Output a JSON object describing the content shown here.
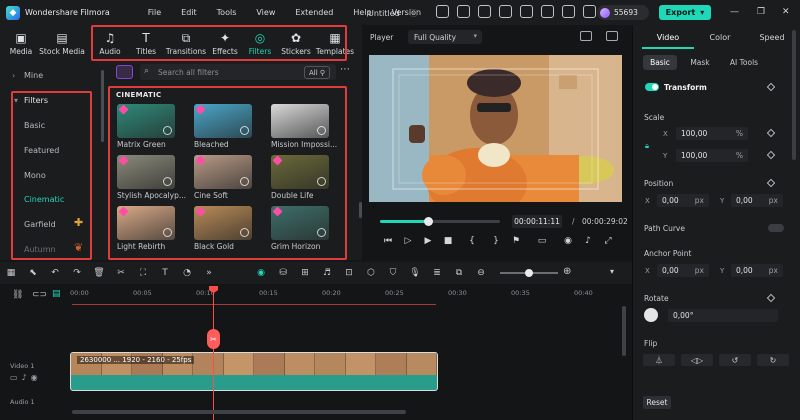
{
  "app": {
    "name": "Wondershare Filmora",
    "doc_title": "Untitled"
  },
  "menu": [
    "File",
    "Edit",
    "Tools",
    "View",
    "Extended",
    "Help",
    "Version"
  ],
  "points": "55693",
  "export_label": "Export",
  "media_tabs": [
    {
      "label": "Media",
      "icon": "media-icon"
    },
    {
      "label": "Stock Media",
      "icon": "stock-media-icon"
    },
    {
      "label": "Audio",
      "icon": "audio-icon"
    },
    {
      "label": "Titles",
      "icon": "titles-icon"
    },
    {
      "label": "Transitions",
      "icon": "transitions-icon"
    },
    {
      "label": "Effects",
      "icon": "effects-icon"
    },
    {
      "label": "Filters",
      "icon": "filters-icon",
      "active": true
    },
    {
      "label": "Stickers",
      "icon": "stickers-icon"
    },
    {
      "label": "Templates",
      "icon": "templates-icon"
    }
  ],
  "sidebar": {
    "mine": "Mine",
    "filters_header": "Filters",
    "items": [
      "Basic",
      "Featured",
      "Mono",
      "Cinematic",
      "Garfield",
      "Autumn"
    ],
    "active": "Cinematic"
  },
  "filter_search": {
    "placeholder": "Search all filters",
    "scope": "All"
  },
  "category_title": "CINEMATIC",
  "filters": [
    {
      "label": "Matrix Green",
      "color": "#2f8a7a"
    },
    {
      "label": "Bleached",
      "color": "#4aa6c9"
    },
    {
      "label": "Mission Impossi...",
      "color": "#d9d9d9"
    },
    {
      "label": "Stylish Apocalyp...",
      "color": "#8a8a7a"
    },
    {
      "label": "Cine Soft",
      "color": "#b89a86"
    },
    {
      "label": "Double Life",
      "color": "#6b6a3a"
    },
    {
      "label": "Light Rebirth",
      "color": "#d9aa88"
    },
    {
      "label": "Black Gold",
      "color": "#b98b58"
    },
    {
      "label": "Grim Horizon",
      "color": "#3e6f6a"
    }
  ],
  "player": {
    "label": "Player",
    "quality": "Full Quality",
    "current_time": "00:00:11:11",
    "total_time": "00:00:29:02",
    "progress": 0.4
  },
  "properties": {
    "tabs": [
      "Video",
      "Color",
      "Speed"
    ],
    "active_tab": "Video",
    "subtabs": [
      "Basic",
      "Mask",
      "AI Tools"
    ],
    "active_subtab": "Basic",
    "transform": "Transform",
    "scale_label": "Scale",
    "scale_x": "100,00",
    "scale_y": "100,00",
    "scale_unit": "%",
    "position_label": "Position",
    "pos_x": "0,00",
    "pos_y": "0,00",
    "pos_unit": "px",
    "path_curve": "Path Curve",
    "anchor_label": "Anchor Point",
    "anchor_x": "0,00",
    "anchor_y": "0,00",
    "rotate_label": "Rotate",
    "rotate_value": "0,00°",
    "flip_label": "Flip",
    "reset": "Reset"
  },
  "timeline": {
    "ruler": [
      "00:00",
      "00:05",
      "00:10",
      "00:15",
      "00:20",
      "00:25",
      "00:30",
      "00:35",
      "00:40"
    ],
    "video_track": "Video 1",
    "audio_track": "Audio 1",
    "clip_name": "2630000 ... 1920 - 2160 - 25fps",
    "zoom": 0.5
  }
}
